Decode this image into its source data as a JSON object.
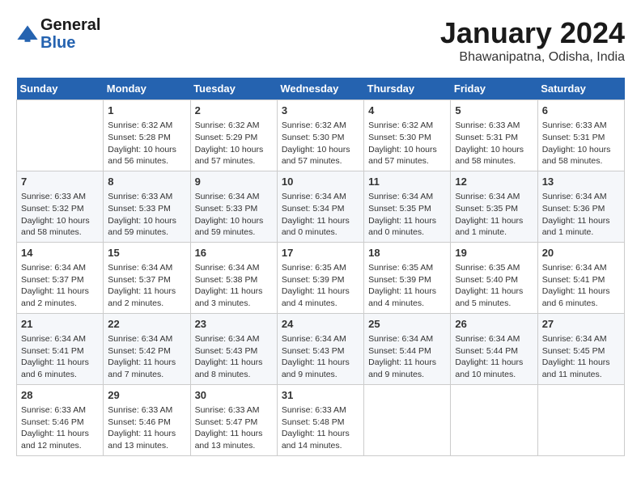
{
  "header": {
    "logo_line1": "General",
    "logo_line2": "Blue",
    "month": "January 2024",
    "location": "Bhawanipatna, Odisha, India"
  },
  "days_of_week": [
    "Sunday",
    "Monday",
    "Tuesday",
    "Wednesday",
    "Thursday",
    "Friday",
    "Saturday"
  ],
  "weeks": [
    [
      {
        "day": "",
        "info": ""
      },
      {
        "day": "1",
        "sunrise": "6:32 AM",
        "sunset": "5:28 PM",
        "daylight": "10 hours and 56 minutes."
      },
      {
        "day": "2",
        "sunrise": "6:32 AM",
        "sunset": "5:29 PM",
        "daylight": "10 hours and 57 minutes."
      },
      {
        "day": "3",
        "sunrise": "6:32 AM",
        "sunset": "5:30 PM",
        "daylight": "10 hours and 57 minutes."
      },
      {
        "day": "4",
        "sunrise": "6:32 AM",
        "sunset": "5:30 PM",
        "daylight": "10 hours and 57 minutes."
      },
      {
        "day": "5",
        "sunrise": "6:33 AM",
        "sunset": "5:31 PM",
        "daylight": "10 hours and 58 minutes."
      },
      {
        "day": "6",
        "sunrise": "6:33 AM",
        "sunset": "5:31 PM",
        "daylight": "10 hours and 58 minutes."
      }
    ],
    [
      {
        "day": "7",
        "sunrise": "6:33 AM",
        "sunset": "5:32 PM",
        "daylight": "10 hours and 58 minutes."
      },
      {
        "day": "8",
        "sunrise": "6:33 AM",
        "sunset": "5:33 PM",
        "daylight": "10 hours and 59 minutes."
      },
      {
        "day": "9",
        "sunrise": "6:34 AM",
        "sunset": "5:33 PM",
        "daylight": "10 hours and 59 minutes."
      },
      {
        "day": "10",
        "sunrise": "6:34 AM",
        "sunset": "5:34 PM",
        "daylight": "11 hours and 0 minutes."
      },
      {
        "day": "11",
        "sunrise": "6:34 AM",
        "sunset": "5:35 PM",
        "daylight": "11 hours and 0 minutes."
      },
      {
        "day": "12",
        "sunrise": "6:34 AM",
        "sunset": "5:35 PM",
        "daylight": "11 hours and 1 minute."
      },
      {
        "day": "13",
        "sunrise": "6:34 AM",
        "sunset": "5:36 PM",
        "daylight": "11 hours and 1 minute."
      }
    ],
    [
      {
        "day": "14",
        "sunrise": "6:34 AM",
        "sunset": "5:37 PM",
        "daylight": "11 hours and 2 minutes."
      },
      {
        "day": "15",
        "sunrise": "6:34 AM",
        "sunset": "5:37 PM",
        "daylight": "11 hours and 2 minutes."
      },
      {
        "day": "16",
        "sunrise": "6:34 AM",
        "sunset": "5:38 PM",
        "daylight": "11 hours and 3 minutes."
      },
      {
        "day": "17",
        "sunrise": "6:35 AM",
        "sunset": "5:39 PM",
        "daylight": "11 hours and 4 minutes."
      },
      {
        "day": "18",
        "sunrise": "6:35 AM",
        "sunset": "5:39 PM",
        "daylight": "11 hours and 4 minutes."
      },
      {
        "day": "19",
        "sunrise": "6:35 AM",
        "sunset": "5:40 PM",
        "daylight": "11 hours and 5 minutes."
      },
      {
        "day": "20",
        "sunrise": "6:34 AM",
        "sunset": "5:41 PM",
        "daylight": "11 hours and 6 minutes."
      }
    ],
    [
      {
        "day": "21",
        "sunrise": "6:34 AM",
        "sunset": "5:41 PM",
        "daylight": "11 hours and 6 minutes."
      },
      {
        "day": "22",
        "sunrise": "6:34 AM",
        "sunset": "5:42 PM",
        "daylight": "11 hours and 7 minutes."
      },
      {
        "day": "23",
        "sunrise": "6:34 AM",
        "sunset": "5:43 PM",
        "daylight": "11 hours and 8 minutes."
      },
      {
        "day": "24",
        "sunrise": "6:34 AM",
        "sunset": "5:43 PM",
        "daylight": "11 hours and 9 minutes."
      },
      {
        "day": "25",
        "sunrise": "6:34 AM",
        "sunset": "5:44 PM",
        "daylight": "11 hours and 9 minutes."
      },
      {
        "day": "26",
        "sunrise": "6:34 AM",
        "sunset": "5:44 PM",
        "daylight": "11 hours and 10 minutes."
      },
      {
        "day": "27",
        "sunrise": "6:34 AM",
        "sunset": "5:45 PM",
        "daylight": "11 hours and 11 minutes."
      }
    ],
    [
      {
        "day": "28",
        "sunrise": "6:33 AM",
        "sunset": "5:46 PM",
        "daylight": "11 hours and 12 minutes."
      },
      {
        "day": "29",
        "sunrise": "6:33 AM",
        "sunset": "5:46 PM",
        "daylight": "11 hours and 13 minutes."
      },
      {
        "day": "30",
        "sunrise": "6:33 AM",
        "sunset": "5:47 PM",
        "daylight": "11 hours and 13 minutes."
      },
      {
        "day": "31",
        "sunrise": "6:33 AM",
        "sunset": "5:48 PM",
        "daylight": "11 hours and 14 minutes."
      },
      {
        "day": "",
        "info": ""
      },
      {
        "day": "",
        "info": ""
      },
      {
        "day": "",
        "info": ""
      }
    ]
  ]
}
